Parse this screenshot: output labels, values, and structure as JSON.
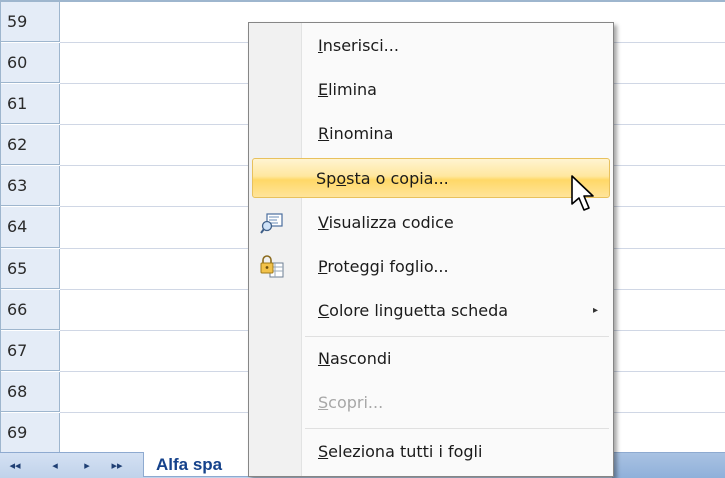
{
  "rows": [
    "59",
    "60",
    "61",
    "62",
    "63",
    "64",
    "65",
    "66",
    "67",
    "68",
    "69"
  ],
  "tabbar": {
    "nav_first": "◂◂",
    "nav_prev": "◂",
    "nav_next": "▸",
    "nav_last": "▸▸",
    "sheet_name": "Alfa spa"
  },
  "menu": {
    "items": [
      {
        "pre": "",
        "acc": "I",
        "post": "nserisci...",
        "icon": "",
        "state": "normal"
      },
      {
        "pre": "",
        "acc": "E",
        "post": "limina",
        "icon": "",
        "state": "normal"
      },
      {
        "pre": "",
        "acc": "R",
        "post": "inomina",
        "icon": "",
        "state": "normal"
      },
      {
        "pre": "Sp",
        "acc": "o",
        "post": "sta o copia...",
        "icon": "",
        "state": "highlight"
      },
      {
        "pre": "",
        "acc": "V",
        "post": "isualizza codice",
        "icon": "view-code-icon",
        "state": "normal"
      },
      {
        "pre": "",
        "acc": "P",
        "post": "roteggi foglio...",
        "icon": "protect-sheet-icon",
        "state": "normal"
      },
      {
        "pre": "",
        "acc": "C",
        "post": "olore linguetta scheda",
        "icon": "",
        "state": "normal",
        "submenu": "▸"
      },
      {
        "pre": "",
        "acc": "N",
        "post": "ascondi",
        "icon": "",
        "state": "normal"
      },
      {
        "pre": "",
        "acc": "S",
        "post": "copri...",
        "icon": "",
        "state": "disabled"
      },
      {
        "pre": "",
        "acc": "S",
        "post": "eleziona tutti i fogli",
        "icon": "",
        "state": "normal"
      }
    ]
  },
  "colors": {
    "highlight_top": "#fff4d1",
    "highlight_bottom": "#ffd867",
    "row_header_bg": "#e4ecf7",
    "sheet_tab_text": "#15428b"
  },
  "cursor_icon": "arrow-pointer-icon"
}
